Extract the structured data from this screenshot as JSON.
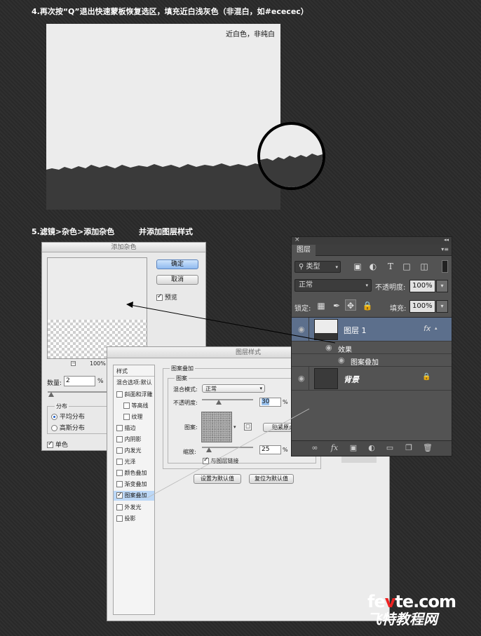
{
  "section4": {
    "title": "4.再次按“Q”退出快速蒙板恢复选区，填充近白浅灰色（非混白，如#ececec）",
    "caption": "近白色，非纯白",
    "fill_color": "#ececec",
    "dark_color": "#3a3a3a"
  },
  "section5": {
    "title": "5.滤镜>杂色>添加杂色",
    "subtitle": "并添加图层样式"
  },
  "add_noise_dialog": {
    "title": "添加杂色",
    "ok_button": "确定",
    "cancel_button": "取消",
    "preview_label": "预览",
    "preview_checked": true,
    "zoom_minus": "−",
    "zoom_plus": "+",
    "zoom_level": "100%",
    "amount_label": "数量:",
    "amount_value": "2",
    "amount_unit": "%",
    "distribution_label": "分布",
    "uniform_label": "平均分布",
    "gaussian_label": "高斯分布",
    "uniform_selected": true,
    "monochrome_label": "单色",
    "monochrome_checked": true
  },
  "layer_style_dialog": {
    "title": "图层样式",
    "styles_header": "样式",
    "blend_default": "混合选项:默认",
    "items": [
      {
        "label": "斜面和浮雕",
        "checked": false,
        "indent": false
      },
      {
        "label": "等高线",
        "checked": false,
        "indent": true
      },
      {
        "label": "纹理",
        "checked": false,
        "indent": true
      },
      {
        "label": "描边",
        "checked": false,
        "indent": false
      },
      {
        "label": "内阴影",
        "checked": false,
        "indent": false
      },
      {
        "label": "内发光",
        "checked": false,
        "indent": false
      },
      {
        "label": "光泽",
        "checked": false,
        "indent": false
      },
      {
        "label": "颜色叠加",
        "checked": false,
        "indent": false
      },
      {
        "label": "渐变叠加",
        "checked": false,
        "indent": false
      },
      {
        "label": "图案叠加",
        "checked": true,
        "indent": false,
        "active": true
      },
      {
        "label": "外发光",
        "checked": false,
        "indent": false
      },
      {
        "label": "投影",
        "checked": false,
        "indent": false
      }
    ],
    "section_title": "图案叠加",
    "group_title": "图案",
    "blend_mode_label": "混合模式:",
    "blend_mode_value": "正常",
    "opacity_label": "不透明度:",
    "opacity_value": "30",
    "opacity_unit": "%",
    "pattern_label": "图案:",
    "snap_button": "贴紧原点",
    "scale_label": "缩放:",
    "scale_value": "25",
    "scale_unit": "%",
    "link_label": "与图层链接",
    "link_checked": true,
    "set_default_button": "设置为默认值",
    "reset_default_button": "复位为默认值"
  },
  "layers_panel": {
    "close_glyph": "×",
    "collapse_glyph": "◂◂",
    "tab_label": "图层",
    "menu_glyph": "▾≡",
    "filter_value": "类型",
    "blend_mode": "正常",
    "opacity_label": "不透明度:",
    "opacity_value": "100%",
    "lock_label": "锁定:",
    "fill_label": "填充:",
    "fill_value": "100%",
    "layers": [
      {
        "name": "图层 1",
        "selected": true,
        "fx": "fx"
      },
      {
        "name": "效果",
        "effect_group": true
      },
      {
        "name": "图案叠加",
        "effect": true
      },
      {
        "name": "背景",
        "locked": true
      }
    ]
  },
  "watermark": {
    "brand_prefix": "fe",
    "brand_mid": "v",
    "brand_suffix": "te.com",
    "brand_cn": "飞特教程网"
  }
}
